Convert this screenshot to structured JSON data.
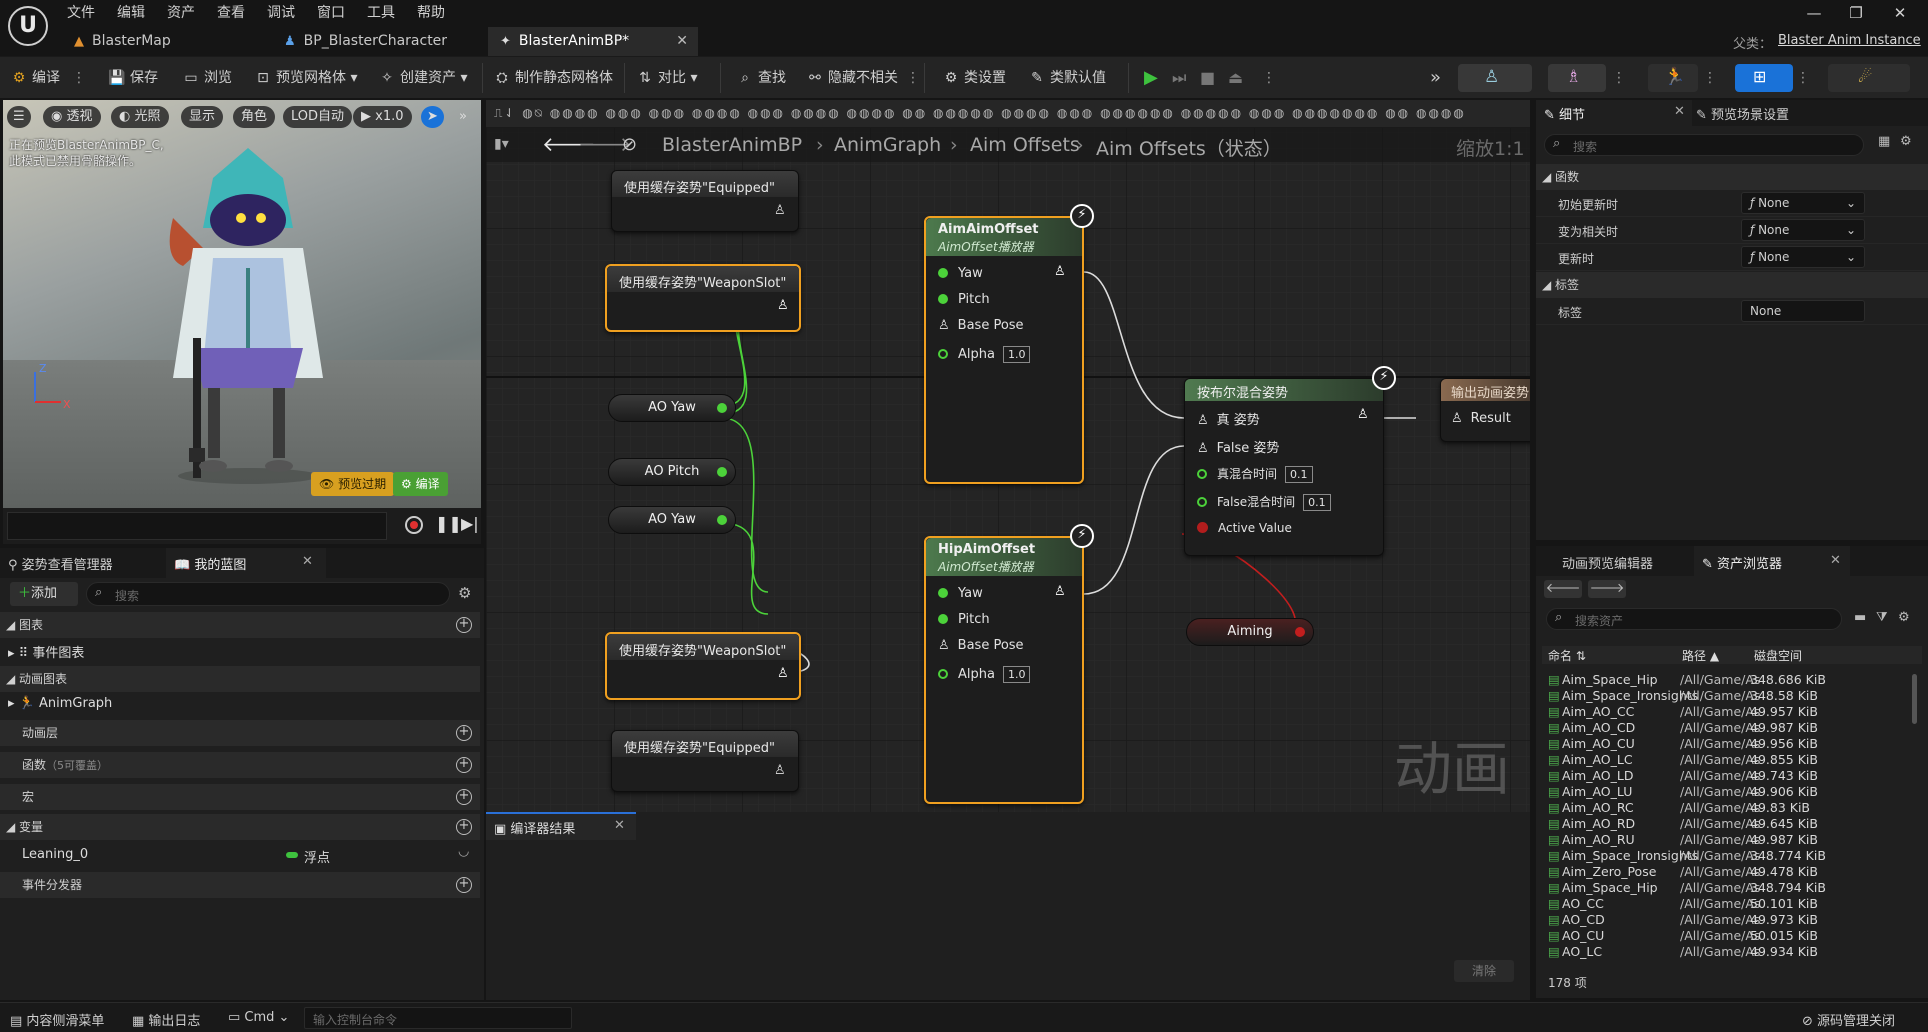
{
  "menubar": {
    "items": [
      "文件",
      "编辑",
      "资产",
      "查看",
      "调试",
      "窗口",
      "工具",
      "帮助"
    ],
    "tabs": [
      "BlasterMap",
      "BP_BlasterCharacter",
      "BlasterAnimBP*"
    ],
    "parent_label": "父类：",
    "parent_class": "Blaster Anim Instance"
  },
  "toolbar": {
    "compile": "编译",
    "save": "保存",
    "browse": "浏览",
    "preview_mesh": "预览网格体",
    "create_asset": "创建资产",
    "make_static_mesh": "制作静态网格体",
    "diff": "对比",
    "find": "查找",
    "hide_unrelated": "隐藏不相关",
    "class_settings": "类设置",
    "class_defaults": "类默认值"
  },
  "viewport": {
    "chips": [
      "透视",
      "光照",
      "显示",
      "角色",
      "LOD自动",
      "x1.0"
    ],
    "note_line1": "正在预览BlasterAnimBP_C,",
    "note_line2": "此模式已禁用骨骼操作。",
    "preview_btn": "预览过期",
    "compile_btn": "编译",
    "axis_z": "Z",
    "axis_x": "X"
  },
  "left_panel": {
    "tabs": [
      "姿势查看管理器",
      "我的蓝图"
    ],
    "add_label": "添加",
    "search_placeholder": "搜索",
    "sections": {
      "graphs": "图表",
      "event_graph": "事件图表",
      "anim_graphs": "动画图表",
      "anim_graph": "AnimGraph",
      "anim_layers": "动画层",
      "functions": "函数",
      "functions_hint": "（5可覆盖）",
      "macros": "宏",
      "variables": "变量",
      "var_name": "Leaning_0",
      "var_type": "浮点",
      "dispatchers": "事件分发器"
    }
  },
  "graph": {
    "breadcrumb": [
      "BlasterAnimBP",
      "AnimGraph",
      "Aim Offsets",
      "Aim Offsets（状态）"
    ],
    "zoom": "缩放1:1",
    "watermark": "动画",
    "cache_nodes": [
      "使用缓存姿势\"Equipped\"",
      "使用缓存姿势\"WeaponSlot\"",
      "使用缓存姿势\"WeaponSlot\"",
      "使用缓存姿势\"Equipped\""
    ],
    "aim_node": {
      "title": "AimAimOffset",
      "subtitle": "AimOffset播放器",
      "yaw": "Yaw",
      "pitch": "Pitch",
      "base_pose": "Base Pose",
      "alpha": "Alpha",
      "alpha_val": "1.0"
    },
    "hip_node": {
      "title": "HipAimOffset",
      "subtitle": "AimOffset播放器",
      "yaw": "Yaw",
      "pitch": "Pitch",
      "base_pose": "Base Pose",
      "alpha": "Alpha",
      "alpha_val": "1.0"
    },
    "var_pills": [
      "AO Yaw",
      "AO Pitch",
      "AO Yaw",
      "Aiming"
    ],
    "blend_node": {
      "title": "按布尔混合姿势",
      "true_pose": "真 姿势",
      "false_pose": "False 姿势",
      "true_time": "真混合时间",
      "true_time_val": "0.1",
      "false_time": "False混合时间",
      "false_time_val": "0.1",
      "active": "Active Value"
    },
    "output_node": {
      "title": "输出动画姿势",
      "result": "Result"
    },
    "compiler_tab": "编译器结果",
    "clear_btn": "清除"
  },
  "details": {
    "tabs": [
      "细节",
      "预览场景设置"
    ],
    "search_placeholder": "搜索",
    "functions_header": "函数",
    "rows": [
      {
        "label": "初始更新时",
        "value": "None"
      },
      {
        "label": "变为相关时",
        "value": "None"
      },
      {
        "label": "更新时",
        "value": "None"
      }
    ],
    "tags_header": "标签",
    "tag_label": "标签",
    "tag_value": "None"
  },
  "assets": {
    "tabs": [
      "动画预览编辑器",
      "资产浏览器"
    ],
    "search_placeholder": "搜索资产",
    "columns": [
      "命名",
      "路径",
      "磁盘空间"
    ],
    "rows": [
      {
        "name": "Aim_Space_Hip",
        "path": "/All/Game/As",
        "size": "348.686 KiB"
      },
      {
        "name": "Aim_Space_Ironsights",
        "path": "/All/Game/As",
        "size": "348.58 KiB"
      },
      {
        "name": "Aim_AO_CC",
        "path": "/All/Game/As",
        "size": "49.957 KiB"
      },
      {
        "name": "Aim_AO_CD",
        "path": "/All/Game/As",
        "size": "49.987 KiB"
      },
      {
        "name": "Aim_AO_CU",
        "path": "/All/Game/As",
        "size": "49.956 KiB"
      },
      {
        "name": "Aim_AO_LC",
        "path": "/All/Game/As",
        "size": "49.855 KiB"
      },
      {
        "name": "Aim_AO_LD",
        "path": "/All/Game/As",
        "size": "49.743 KiB"
      },
      {
        "name": "Aim_AO_LU",
        "path": "/All/Game/As",
        "size": "49.906 KiB"
      },
      {
        "name": "Aim_AO_RC",
        "path": "/All/Game/As",
        "size": "49.83 KiB"
      },
      {
        "name": "Aim_AO_RD",
        "path": "/All/Game/As",
        "size": "49.645 KiB"
      },
      {
        "name": "Aim_AO_RU",
        "path": "/All/Game/As",
        "size": "49.987 KiB"
      },
      {
        "name": "Aim_Space_Ironsights",
        "path": "/All/Game/As",
        "size": "348.774 KiB"
      },
      {
        "name": "Aim_Zero_Pose",
        "path": "/All/Game/As",
        "size": "49.478 KiB"
      },
      {
        "name": "Aim_Space_Hip",
        "path": "/All/Game/As",
        "size": "348.794 KiB"
      },
      {
        "name": "AO_CC",
        "path": "/All/Game/As",
        "size": "50.101 KiB"
      },
      {
        "name": "AO_CD",
        "path": "/All/Game/As",
        "size": "49.973 KiB"
      },
      {
        "name": "AO_CU",
        "path": "/All/Game/As",
        "size": "50.015 KiB"
      },
      {
        "name": "AO_LC",
        "path": "/All/Game/As",
        "size": "49.934 KiB"
      }
    ],
    "count": "178 项"
  },
  "statusbar": {
    "content_drawer": "内容侧滑菜单",
    "output_log": "输出日志",
    "cmd": "Cmd",
    "console_placeholder": "输入控制台命令",
    "source_control": "源码管理关闭"
  }
}
